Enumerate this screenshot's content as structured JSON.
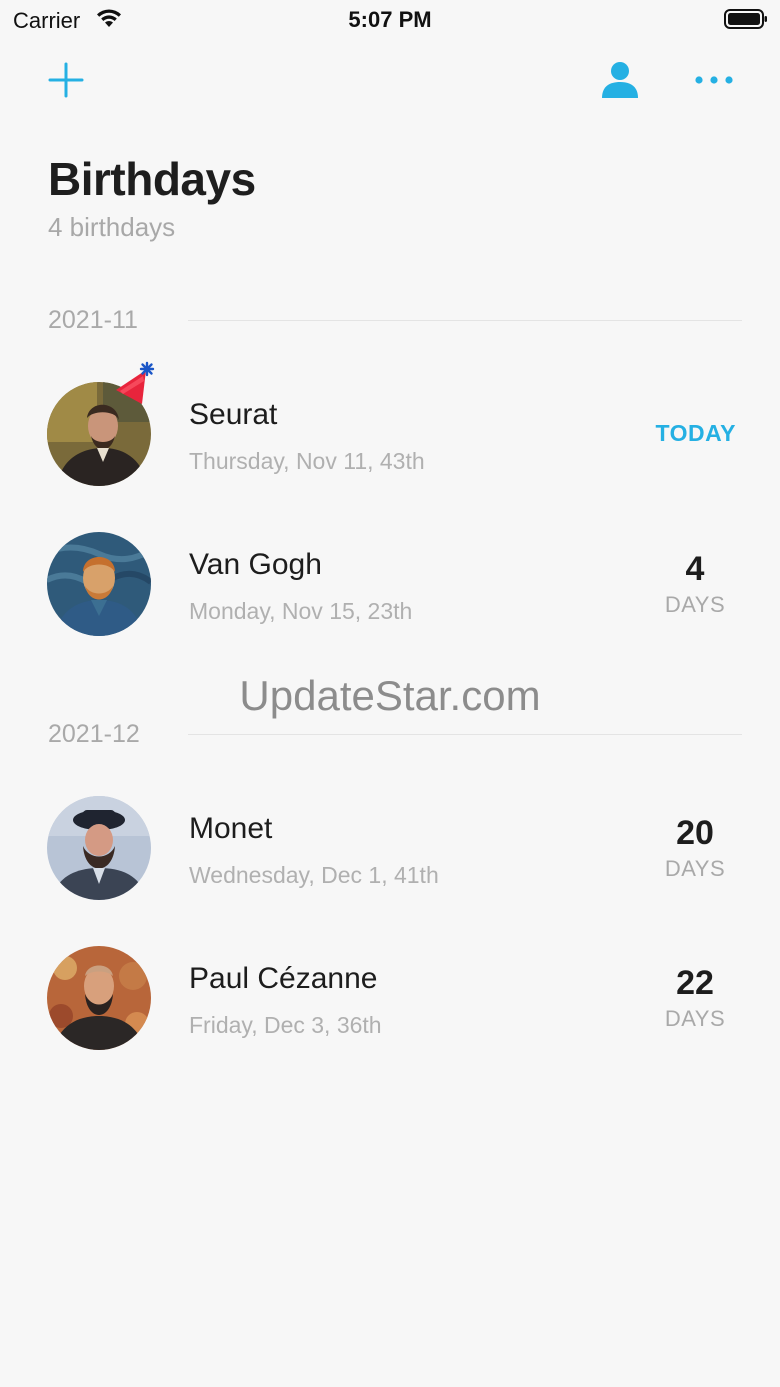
{
  "status_bar": {
    "carrier": "Carrier",
    "time": "5:07 PM"
  },
  "nav": {
    "add_icon": "plus-icon",
    "profile_icon": "person-icon",
    "more_icon": "ellipsis-icon"
  },
  "header": {
    "title": "Birthdays",
    "subtitle": "4 birthdays"
  },
  "sections": [
    {
      "label": "2021-11",
      "rows": [
        {
          "name": "Seurat",
          "date": "Thursday, Nov 11, 43th",
          "status": "TODAY",
          "decoration": "party-hat-icon"
        },
        {
          "name": "Van Gogh",
          "date": "Monday, Nov 15, 23th",
          "count": "4",
          "unit": "DAYS"
        }
      ]
    },
    {
      "label": "2021-12",
      "rows": [
        {
          "name": "Monet",
          "date": "Wednesday, Dec 1, 41th",
          "count": "20",
          "unit": "DAYS"
        },
        {
          "name": "Paul Cézanne",
          "date": "Friday, Dec 3, 36th",
          "count": "22",
          "unit": "DAYS"
        }
      ]
    }
  ],
  "watermark": "UpdateStar.com",
  "colors": {
    "accent": "#25b0e3",
    "background": "#f7f7f7",
    "secondary_text": "#a9a9a9"
  }
}
